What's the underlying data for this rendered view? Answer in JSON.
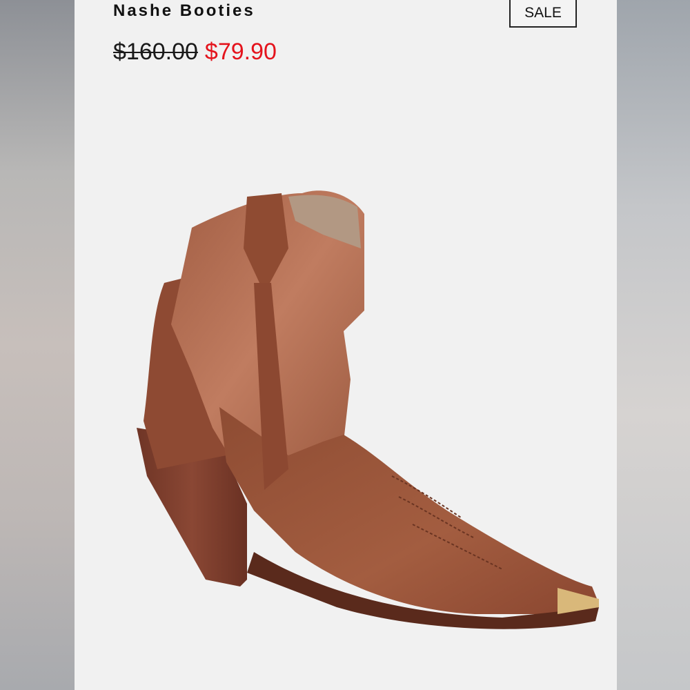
{
  "product": {
    "title": "Nashe Booties",
    "badge": "SALE",
    "original_price": "$160.00",
    "sale_price": "$79.90"
  },
  "colors": {
    "sale_price": "#e4131c",
    "boot_leather": "#9a5538",
    "boot_shaft": "#b46e52",
    "heel": "#7e3f2c",
    "toe_cap": "#d9b87a"
  },
  "image": {
    "icon": "western-ankle-boot-icon"
  }
}
